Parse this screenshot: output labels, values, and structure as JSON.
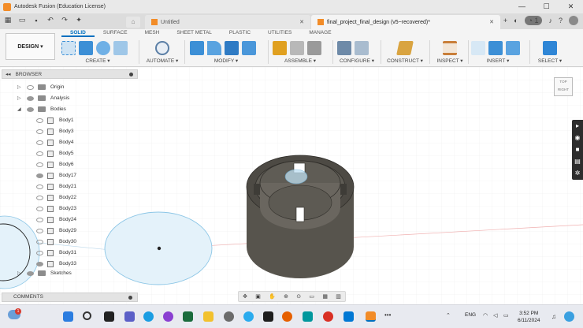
{
  "window": {
    "title": "Autodesk Fusion (Education License)",
    "controls": [
      "—",
      "☐",
      "✕"
    ]
  },
  "tabs": {
    "inactive_label": "Untitled",
    "active_label": "final_project_final_design (v5~recovered)*",
    "close": "✕",
    "new_tab": "+",
    "job_count": "1"
  },
  "ribbon": {
    "workspace": "DESIGN ▾",
    "tabs": [
      "SOLID",
      "SURFACE",
      "MESH",
      "SHEET METAL",
      "PLASTIC",
      "UTILITIES",
      "MANAGE"
    ],
    "groups": [
      "CREATE ▾",
      "AUTOMATE ▾",
      "MODIFY ▾",
      "ASSEMBLE ▾",
      "CONFIGURE ▾",
      "CONSTRUCT ▾",
      "INSPECT ▾",
      "INSERT ▾",
      "SELECT ▾"
    ],
    "group_colors": {
      "create": "#3c8fd6",
      "automate": "#5b7fa6",
      "modify": "#3c8fd6",
      "assemble": "#e0a020",
      "configure": "#6e8aa8",
      "construct": "#d9a441",
      "inspect": "#c97f3a",
      "insert": "#3c8fd6",
      "select": "#2f86d6"
    }
  },
  "browser": {
    "header": "BROWSER",
    "collapse": "◂◂",
    "folders": [
      "Origin",
      "Analysis",
      "Bodies"
    ],
    "bodies": [
      "Body1",
      "Body3",
      "Body4",
      "Body5",
      "Body6",
      "Body17",
      "Body21",
      "Body22",
      "Body23",
      "Body24",
      "Body29",
      "Body30",
      "Body31",
      "Body33"
    ],
    "sketches": "Sketches"
  },
  "comments": {
    "label": "COMMENTS"
  },
  "viewcube": {
    "top": "TOP",
    "front": "FRONT",
    "right": "RIGHT"
  },
  "taskbar": {
    "notification_badge": "1",
    "language": "ENG",
    "time": "3:52 PM",
    "date": "6/11/2024",
    "more": "•••"
  },
  "colors": {
    "accent": "#0070c0",
    "part_body": "#5a574f",
    "part_shadow": "#3e3c37",
    "sketch_fill": "#d7ecf7",
    "sketch_stroke": "#7fbfe0",
    "grid": "#e8e8e8"
  }
}
